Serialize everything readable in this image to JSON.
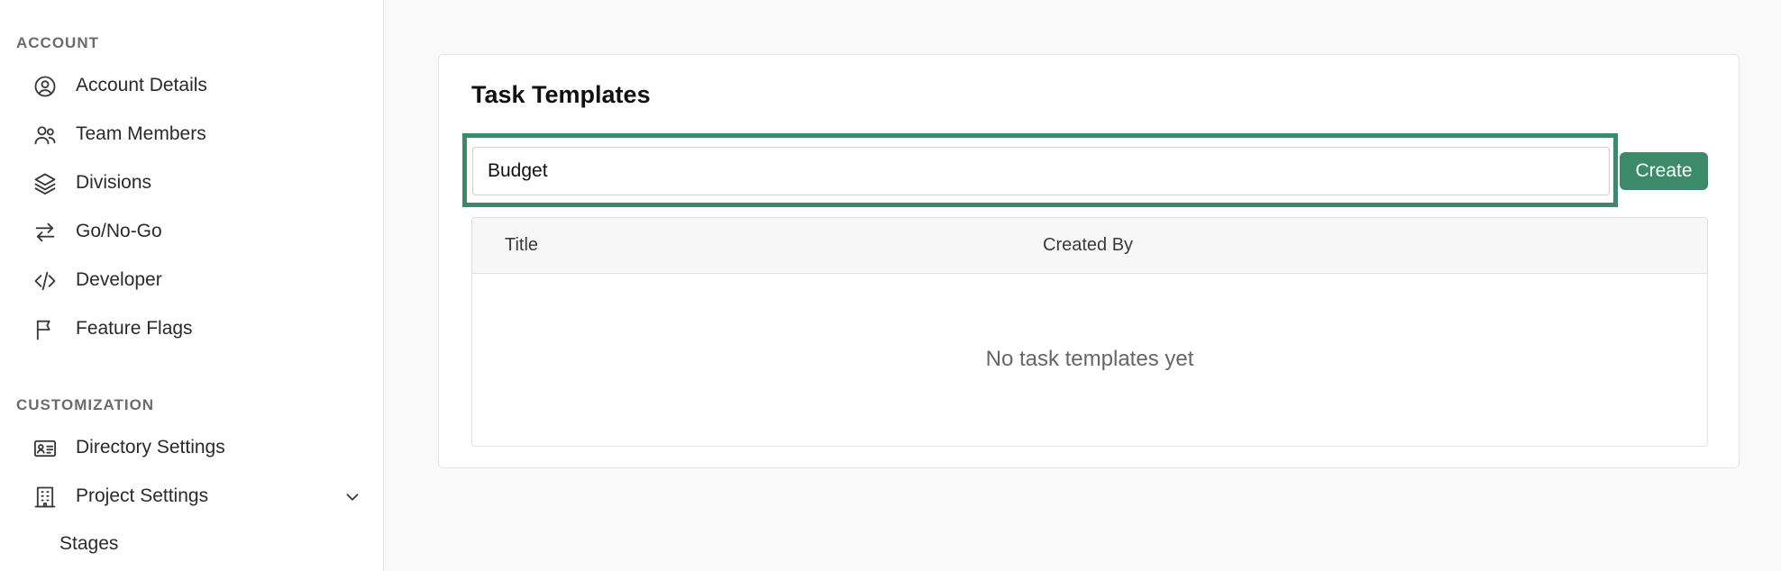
{
  "sidebar": {
    "account_heading": "ACCOUNT",
    "account_items": [
      {
        "label": "Account Details",
        "icon": "user-circle-icon"
      },
      {
        "label": "Team Members",
        "icon": "users-icon"
      },
      {
        "label": "Divisions",
        "icon": "layers-icon"
      },
      {
        "label": "Go/No-Go",
        "icon": "arrows-exchange-icon"
      },
      {
        "label": "Developer",
        "icon": "code-icon"
      },
      {
        "label": "Feature Flags",
        "icon": "flag-icon"
      }
    ],
    "customization_heading": "CUSTOMIZATION",
    "customization_items": [
      {
        "label": "Directory Settings",
        "icon": "id-card-icon"
      },
      {
        "label": "Project Settings",
        "icon": "building-icon"
      }
    ],
    "project_settings_subitems": [
      {
        "label": "Stages"
      }
    ]
  },
  "main": {
    "title": "Task Templates",
    "input": {
      "value": "Budget",
      "placeholder": ""
    },
    "create_label": "Create",
    "table": {
      "columns": [
        "Title",
        "Created By"
      ],
      "empty_message": "No task templates yet"
    }
  },
  "colors": {
    "accent": "#3d8a6a"
  }
}
